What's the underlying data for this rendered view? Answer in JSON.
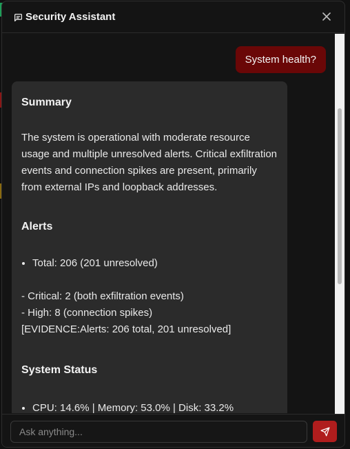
{
  "header": {
    "title": "Security Assistant",
    "chat_icon": "message-square-icon",
    "close_icon": "close-icon"
  },
  "conversation": {
    "user_message": "System health?",
    "assistant": {
      "summary_heading": "Summary",
      "summary_text": "The system is operational with moderate resource usage and multiple unresolved alerts. Critical exfiltration events and connection spikes are present, primarily from external IPs and loopback addresses.",
      "alerts_heading": "Alerts",
      "alerts_bullets": [
        "Total: 206 (201 unresolved)"
      ],
      "alerts_lines": [
        "- Critical: 2 (both exfiltration events)",
        "- High: 8 (connection spikes)",
        "[EVIDENCE:Alerts: 206 total, 201 unresolved]"
      ],
      "system_heading": "System Status",
      "system_bullets": [
        "CPU: 14.6% | Memory: 53.0% | Disk: 33.2%"
      ]
    }
  },
  "composer": {
    "placeholder": "Ask anything...",
    "send_icon": "send-icon"
  },
  "colors": {
    "accent": "#b01d1d",
    "user_bubble": "#6a0707",
    "assistant_bubble": "#2b2b2b",
    "panel_bg": "#141414"
  }
}
